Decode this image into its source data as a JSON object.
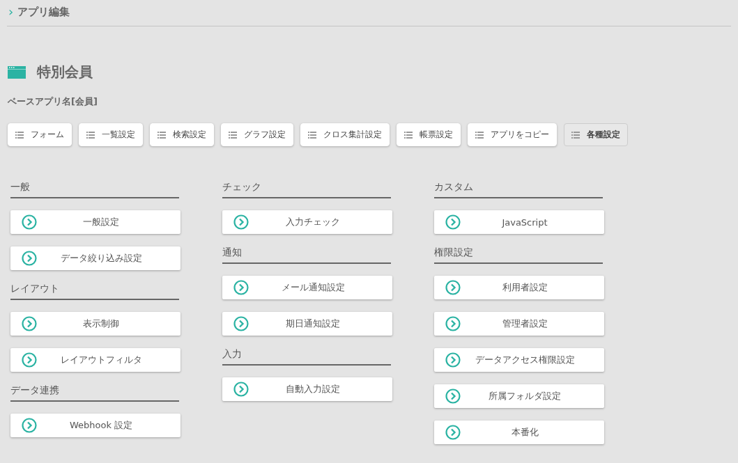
{
  "breadcrumb": {
    "icon": "›",
    "label": "アプリ編集"
  },
  "app": {
    "title": "特別会員",
    "base_app": "ベースアプリ名[会員]"
  },
  "tabs": [
    {
      "label": "フォーム",
      "selected": false
    },
    {
      "label": "一覧設定",
      "selected": false
    },
    {
      "label": "検索設定",
      "selected": false
    },
    {
      "label": "グラフ設定",
      "selected": false
    },
    {
      "label": "クロス集計設定",
      "selected": false
    },
    {
      "label": "帳票設定",
      "selected": false
    },
    {
      "label": "アプリをコピー",
      "selected": false
    },
    {
      "label": "各種設定",
      "selected": true
    }
  ],
  "columns": [
    [
      {
        "heading": "一般",
        "buttons": [
          "一般設定",
          "データ絞り込み設定"
        ]
      },
      {
        "heading": "レイアウト",
        "buttons": [
          "表示制御",
          "レイアウトフィルタ"
        ]
      },
      {
        "heading": "データ連携",
        "buttons": [
          "Webhook 設定"
        ]
      }
    ],
    [
      {
        "heading": "チェック",
        "buttons": [
          "入力チェック"
        ]
      },
      {
        "heading": "通知",
        "buttons": [
          "メール通知設定",
          "期日通知設定"
        ]
      },
      {
        "heading": "入力",
        "buttons": [
          "自動入力設定"
        ]
      }
    ],
    [
      {
        "heading": "カスタム",
        "buttons": [
          "JavaScript"
        ]
      },
      {
        "heading": "権限設定",
        "buttons": [
          "利用者設定",
          "管理者設定",
          "データアクセス権限設定",
          "所属フォルダ設定",
          "本番化"
        ]
      }
    ]
  ]
}
